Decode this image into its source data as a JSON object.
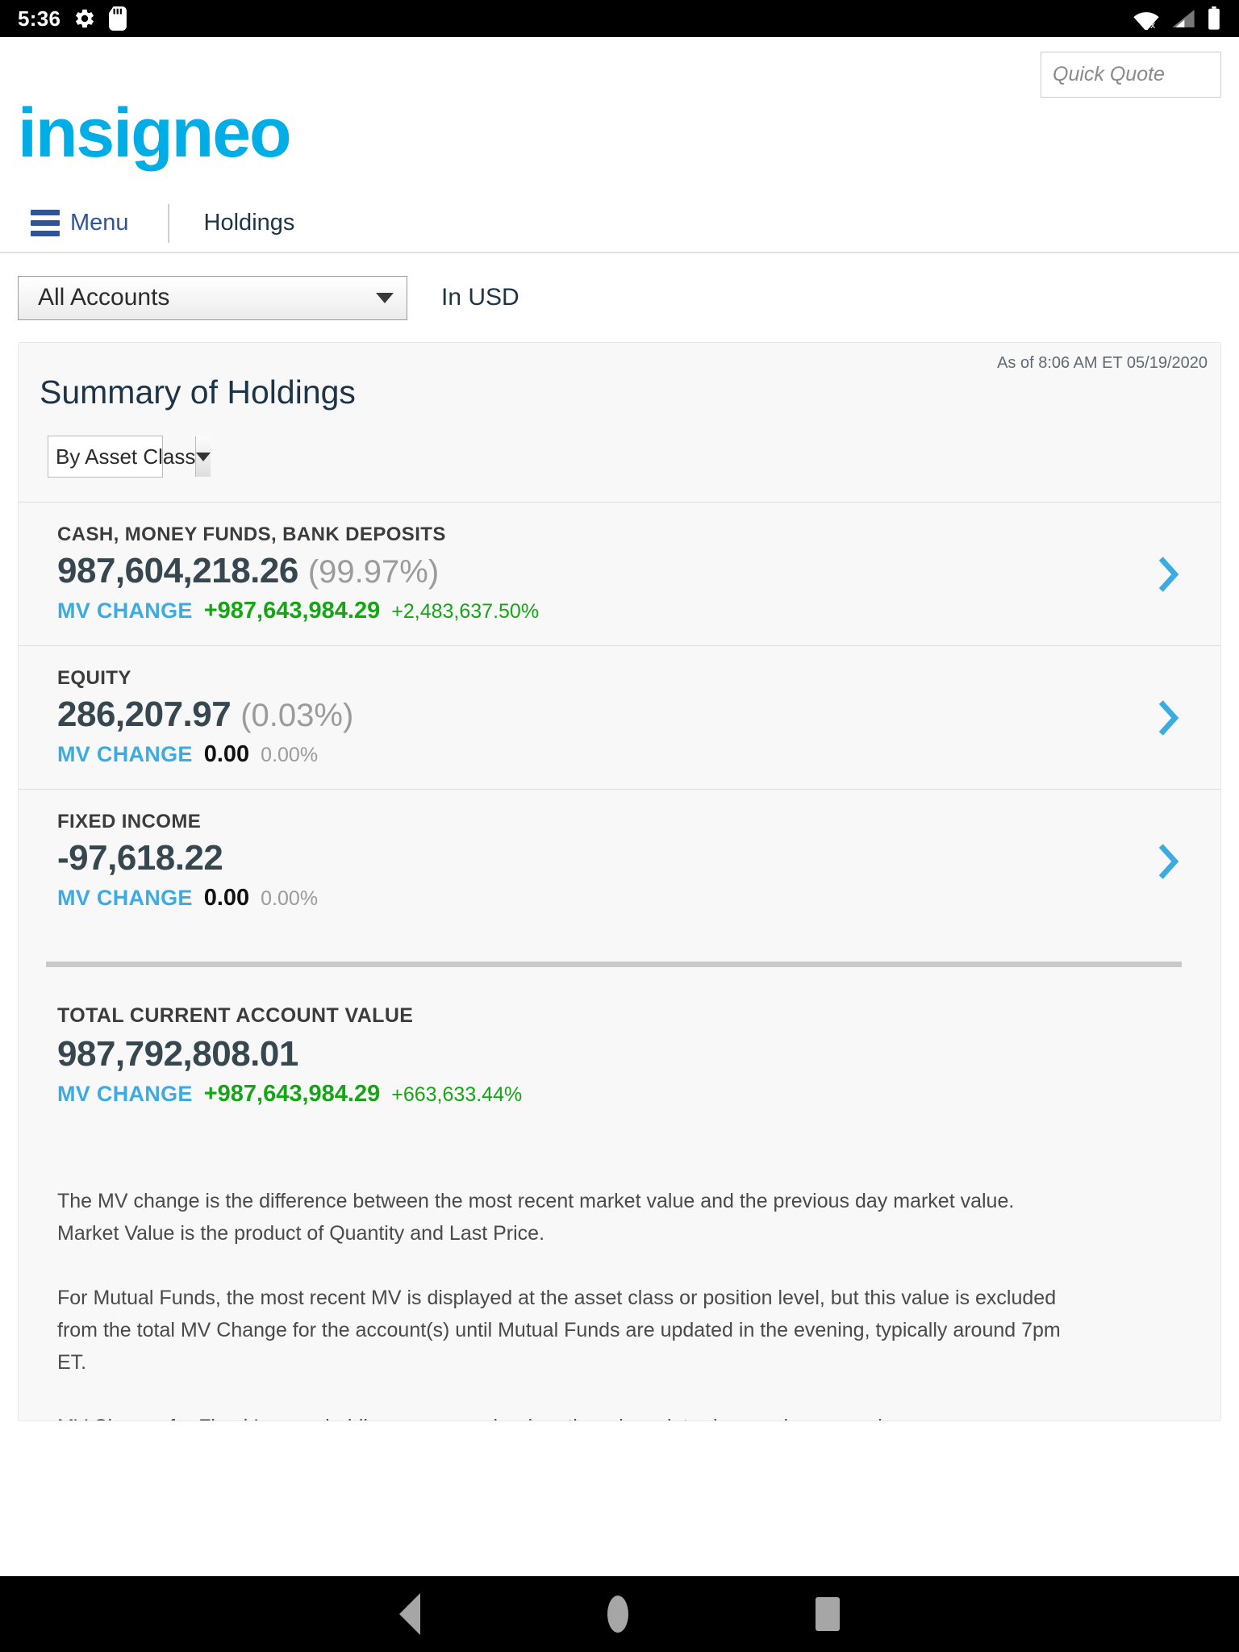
{
  "status_bar": {
    "time": "5:36",
    "left_icons": [
      "gear-icon",
      "sd-card-icon"
    ],
    "right_icons": [
      "wifi-off-icon",
      "cell-signal-icon",
      "battery-icon"
    ]
  },
  "header": {
    "brand": "insigneo",
    "brand_color": "#00ADE5",
    "quick_quote_placeholder": "Quick Quote",
    "quick_quote_value": ""
  },
  "navbar": {
    "menu_label": "Menu",
    "breadcrumb": "Holdings",
    "menu_color": "#2f5597"
  },
  "filters": {
    "account_selected": "All Accounts",
    "currency_label": "In USD"
  },
  "summary": {
    "title": "Summary of Holdings",
    "as_of": "As of  8:06 AM ET 05/19/2020",
    "group_by_selected": "By Asset Class",
    "mv_change_label": "MV CHANGE",
    "rows": [
      {
        "label": "CASH, MONEY FUNDS, BANK DEPOSITS",
        "value": "987,604,218.26",
        "allocation": "(99.97%)",
        "mv_change_amount": "+987,643,984.29",
        "mv_change_pct": "+2,483,637.50%",
        "mv_state": "positive"
      },
      {
        "label": "EQUITY",
        "value": "286,207.97",
        "allocation": "(0.03%)",
        "mv_change_amount": "0.00",
        "mv_change_pct": "0.00%",
        "mv_state": "zero"
      },
      {
        "label": "FIXED INCOME",
        "value": "-97,618.22",
        "allocation": "",
        "mv_change_amount": "0.00",
        "mv_change_pct": "0.00%",
        "mv_state": "zero"
      }
    ],
    "total": {
      "label": "TOTAL CURRENT ACCOUNT VALUE",
      "value": "987,792,808.01",
      "mv_change_amount": "+987,643,984.29",
      "mv_change_pct": "+663,633.44%"
    }
  },
  "notes": {
    "p1": "The MV change is the difference between the most recent market value and the previous day market value. Market Value is the product of Quantity and Last Price.",
    "p2": "For Mutual Funds, the most recent MV is displayed at the asset class or position level, but this value is excluded from the total MV Change for the account(s) until Mutual Funds are updated in the evening, typically around 7pm ET.",
    "p3": "MV Change for Fixed Income holdings occurs only when there is an intraday purchase or sale."
  },
  "colors": {
    "accent_cyan": "#00ADE5",
    "mv_label_blue": "#3cabe2",
    "positive_green": "#17a517",
    "chevron_blue": "#3cabe2"
  }
}
